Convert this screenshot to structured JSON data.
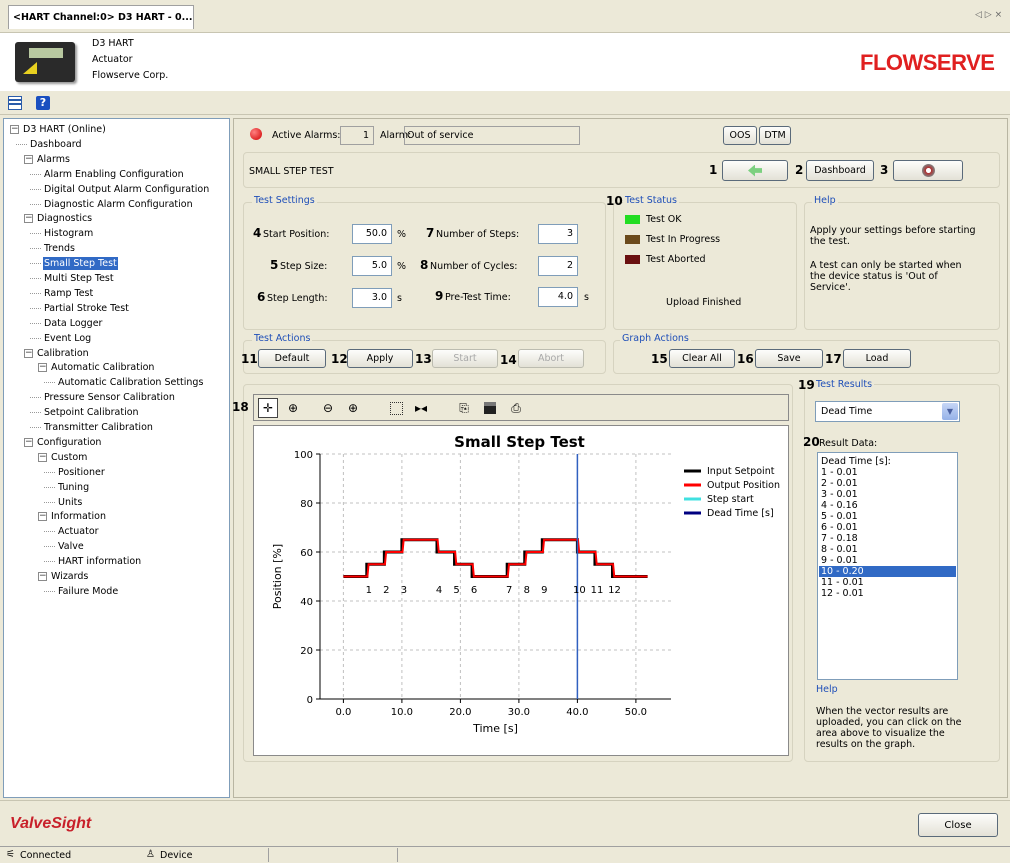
{
  "tab": {
    "title": "<HART Channel:0> D3 HART - 0...",
    "nav": "◁ ▷ ×"
  },
  "device": {
    "name": "D3 HART",
    "type": "Actuator",
    "vendor": "Flowserve Corp."
  },
  "brand": "FLOWSERVE",
  "tree": [
    {
      "label": "D3 HART (Online)",
      "level": 0,
      "exp": true
    },
    {
      "label": "Dashboard",
      "level": 1
    },
    {
      "label": "Alarms",
      "level": 1,
      "exp": true
    },
    {
      "label": "Alarm Enabling Configuration",
      "level": 2
    },
    {
      "label": "Digital Output Alarm Configuration",
      "level": 2
    },
    {
      "label": "Diagnostic Alarm Configuration",
      "level": 2
    },
    {
      "label": "Diagnostics",
      "level": 1,
      "exp": true
    },
    {
      "label": "Histogram",
      "level": 2
    },
    {
      "label": "Trends",
      "level": 2
    },
    {
      "label": "Small Step Test",
      "level": 2,
      "selected": true
    },
    {
      "label": "Multi Step Test",
      "level": 2
    },
    {
      "label": "Ramp Test",
      "level": 2
    },
    {
      "label": "Partial Stroke Test",
      "level": 2
    },
    {
      "label": "Data Logger",
      "level": 2
    },
    {
      "label": "Event Log",
      "level": 2
    },
    {
      "label": "Calibration",
      "level": 1,
      "exp": true
    },
    {
      "label": "Automatic Calibration",
      "level": 2,
      "exp": true
    },
    {
      "label": "Automatic Calibration Settings",
      "level": 3
    },
    {
      "label": "Pressure Sensor Calibration",
      "level": 2
    },
    {
      "label": "Setpoint Calibration",
      "level": 2
    },
    {
      "label": "Transmitter Calibration",
      "level": 2
    },
    {
      "label": "Configuration",
      "level": 1,
      "exp": true
    },
    {
      "label": "Custom",
      "level": 2,
      "exp": true
    },
    {
      "label": "Positioner",
      "level": 3
    },
    {
      "label": "Tuning",
      "level": 3
    },
    {
      "label": "Units",
      "level": 3
    },
    {
      "label": "Information",
      "level": 2,
      "exp": true
    },
    {
      "label": "Actuator",
      "level": 3
    },
    {
      "label": "Valve",
      "level": 3
    },
    {
      "label": "HART information",
      "level": 3
    },
    {
      "label": "Wizards",
      "level": 2,
      "exp": true
    },
    {
      "label": "Failure Mode",
      "level": 3
    }
  ],
  "alarm": {
    "label": "Active Alarms:",
    "count": "1",
    "alarm_label": "Alarm:",
    "alarm_text": "Out of service",
    "oos": "OOS",
    "dtm": "DTM"
  },
  "header": {
    "title": "SMALL STEP TEST",
    "n1": "1",
    "n2": "2",
    "dashboard": "Dashboard",
    "n3": "3"
  },
  "settings": {
    "title": "Test Settings",
    "n4": "4",
    "start_label": "Start Position:",
    "start_val": "50.0",
    "start_unit": "%",
    "n5": "5",
    "step_label": "Step Size:",
    "step_val": "5.0",
    "step_unit": "%",
    "n6": "6",
    "len_label": "Step Length:",
    "len_val": "3.0",
    "len_unit": "s",
    "n7": "7",
    "nsteps_label": "Number of Steps:",
    "nsteps_val": "3",
    "n8": "8",
    "ncyc_label": "Number of Cycles:",
    "ncyc_val": "2",
    "n9": "9",
    "pre_label": "Pre-Test Time:",
    "pre_val": "4.0",
    "pre_unit": "s"
  },
  "status": {
    "n": "10",
    "title": "Test Status",
    "ok": "Test OK",
    "inprog": "Test In Progress",
    "aborted": "Test Aborted",
    "upload": "Upload Finished",
    "c_ok": "#22dd22",
    "c_inprog": "#6b4a1c",
    "c_aborted": "#6a1010"
  },
  "help1": {
    "title": "Help",
    "p1": "Apply your settings before starting the test.",
    "p2": "A test can only be started when the device status is 'Out of Service'."
  },
  "actions": {
    "title": "Test Actions",
    "n11": "11",
    "default": "Default",
    "n12": "12",
    "apply": "Apply",
    "n13": "13",
    "start": "Start",
    "n14": "14",
    "abort": "Abort"
  },
  "graph_actions": {
    "title": "Graph Actions",
    "n15": "15",
    "clear": "Clear All",
    "n16": "16",
    "save": "Save",
    "n17": "17",
    "load": "Load"
  },
  "toolbar": {
    "n": "18"
  },
  "results": {
    "n19": "19",
    "title": "Test Results",
    "selected": "Dead Time",
    "n20": "20",
    "data_label": "Result Data:",
    "items": [
      "Dead Time [s]:",
      "1  - 0.01",
      "2  - 0.01",
      "3  - 0.01",
      "4  - 0.16",
      "5  - 0.01",
      "6  - 0.01",
      "7  - 0.18",
      "8  - 0.01",
      "9  - 0.01",
      "10  - 0.20",
      "11  - 0.01",
      "12  - 0.01"
    ],
    "selected_index": 10
  },
  "help2": {
    "title": "Help",
    "text": "When the vector results are uploaded, you can click on the area above to visualize the results on the graph."
  },
  "chart_data": {
    "type": "line",
    "title": "Small Step Test",
    "xlabel": "Time [s]",
    "ylabel": "Position [%]",
    "xlim": [
      -4,
      56
    ],
    "ylim": [
      0,
      100
    ],
    "xticks": [
      0,
      10,
      20,
      30,
      40,
      50
    ],
    "yticks": [
      0,
      20,
      40,
      60,
      80,
      100
    ],
    "xtick_labels": [
      "0.0",
      "10.0",
      "20.0",
      "30.0",
      "40.0",
      "50.0"
    ],
    "ytick_labels": [
      "0",
      "20",
      "40",
      "60",
      "80",
      "100"
    ],
    "grid": true,
    "legend_position": "top-right",
    "series": [
      {
        "name": "Input Setpoint",
        "color": "#000000",
        "x": [
          0,
          4,
          4,
          7,
          7,
          10,
          10,
          16,
          16,
          19,
          19,
          22,
          22,
          28,
          28,
          31,
          31,
          34,
          34,
          40,
          40,
          43,
          43,
          46,
          46,
          52
        ],
        "y": [
          50,
          50,
          55,
          55,
          60,
          60,
          65,
          65,
          60,
          60,
          55,
          55,
          50,
          50,
          55,
          55,
          60,
          60,
          65,
          65,
          60,
          60,
          55,
          55,
          50,
          50
        ]
      },
      {
        "name": "Output Position",
        "color": "#ff0000",
        "x": [
          0,
          4.1,
          4.3,
          7.1,
          7.3,
          10.1,
          10.3,
          16.1,
          16.3,
          19.1,
          19.3,
          22.1,
          22.3,
          28.1,
          28.3,
          31.1,
          31.3,
          34.1,
          34.3,
          40.1,
          40.3,
          43.1,
          43.3,
          46.1,
          46.3,
          52
        ],
        "y": [
          50,
          50,
          55,
          55,
          60,
          60,
          65,
          65,
          60,
          60,
          55,
          55,
          50,
          50,
          55,
          55,
          60,
          60,
          65,
          65,
          60,
          60,
          55,
          55,
          50,
          50
        ]
      },
      {
        "name": "Step start",
        "color": "#40e0e0"
      },
      {
        "name": "Dead Time [s]",
        "color": "#000080"
      }
    ],
    "marker_line_x": 40,
    "marker_line_color": "#3060c0",
    "step_labels": [
      {
        "t": "1",
        "x": 4
      },
      {
        "t": "2",
        "x": 7
      },
      {
        "t": "3",
        "x": 10
      },
      {
        "t": "4",
        "x": 16
      },
      {
        "t": "5",
        "x": 19
      },
      {
        "t": "6",
        "x": 22
      },
      {
        "t": "7",
        "x": 28
      },
      {
        "t": "8",
        "x": 31
      },
      {
        "t": "9",
        "x": 34
      },
      {
        "t": "10",
        "x": 40
      },
      {
        "t": "11",
        "x": 43
      },
      {
        "t": "12",
        "x": 46
      }
    ],
    "step_label_y": 45
  },
  "footer": {
    "brand": "ValveSight",
    "close": "Close"
  },
  "statusbar": {
    "connected": "Connected",
    "device": "Device"
  }
}
